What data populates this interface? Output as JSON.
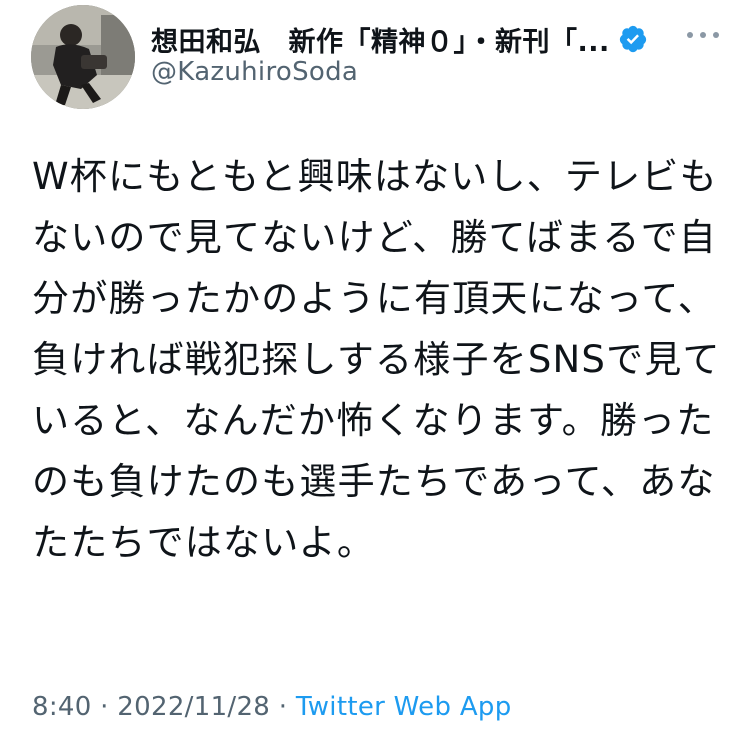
{
  "author": {
    "display_name": "想田和弘　新作「精神０」・新刊「...",
    "handle": "@KazuhiroSoda",
    "verified": true,
    "verified_color": "#1d9bf0",
    "avatar_icon": "profile-photo"
  },
  "menu": {
    "icon": "more-horizontal-icon"
  },
  "tweet": {
    "text": "W杯にもともと興味はないし、テレビもないので見てないけど、勝てばまるで自分が勝ったかのように有頂天になって、負ければ戦犯探しする様子をSNSで見ていると、なんだか怖くなります。勝ったのも負けたのも選手たちであって、あなたたちではないよ。"
  },
  "meta": {
    "time": "8:40",
    "separator1": " · ",
    "date": "2022/11/28",
    "separator2": " · ",
    "source": "Twitter Web App"
  },
  "colors": {
    "text": "#0f1419",
    "secondary": "#536471",
    "link": "#1d9bf0"
  }
}
